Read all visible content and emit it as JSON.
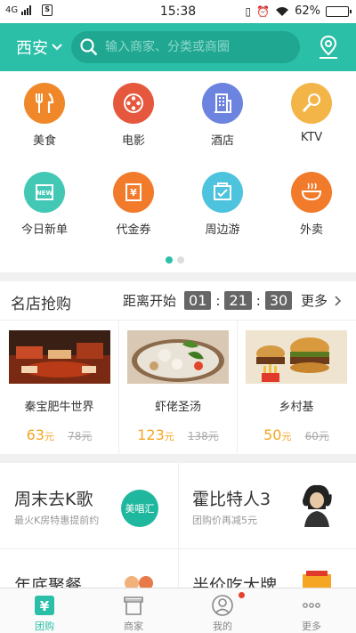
{
  "status_bar": {
    "network": "4G",
    "time": "15:38",
    "battery": "62%",
    "battery_level": 0.62
  },
  "header": {
    "city": "西安",
    "search_placeholder": "输入商家、分类或商圈",
    "accent_color": "#2bbfa8"
  },
  "categories": [
    {
      "label": "美食",
      "icon": "food-icon",
      "color": "#f0882a"
    },
    {
      "label": "电影",
      "icon": "film-reel-icon",
      "color": "#e5583d"
    },
    {
      "label": "酒店",
      "icon": "hotel-icon",
      "color": "#6c84e0"
    },
    {
      "label": "KTV",
      "icon": "microphone-icon",
      "color": "#f3b547"
    },
    {
      "label": "今日新单",
      "icon": "new-badge-icon",
      "color": "#42c8b5"
    },
    {
      "label": "代金券",
      "icon": "voucher-icon",
      "color": "#f27a2b"
    },
    {
      "label": "周边游",
      "icon": "travel-ticket-icon",
      "color": "#4ec3dd"
    },
    {
      "label": "外卖",
      "icon": "takeout-bowl-icon",
      "color": "#f27a2b"
    }
  ],
  "page_indicator": {
    "total": 2,
    "current": 1
  },
  "flash_sale": {
    "title": "名店抢购",
    "countdown_label": "距离开始",
    "hours": "01",
    "minutes": "21",
    "seconds": "30",
    "more_label": "更多",
    "products": [
      {
        "name": "秦宝肥牛世界",
        "price": "63",
        "unit": "元",
        "original": "78元"
      },
      {
        "name": "虾佬圣汤",
        "price": "123",
        "unit": "元",
        "original": "138元"
      },
      {
        "name": "乡村基",
        "price": "50",
        "unit": "元",
        "original": "60元"
      }
    ]
  },
  "promos": [
    {
      "title": "周末去K歌",
      "subtitle": "最火K房特惠提前约",
      "badge": "美唱汇"
    },
    {
      "title": "霍比特人3",
      "subtitle": "团购价再减5元"
    },
    {
      "title": "年底聚餐",
      "subtitle": ""
    },
    {
      "title": "半价吃大牌",
      "subtitle": ""
    }
  ],
  "tabs": [
    {
      "label": "团购",
      "icon": "yuan-bag-icon",
      "active": true
    },
    {
      "label": "商家",
      "icon": "storefront-icon"
    },
    {
      "label": "我的",
      "icon": "user-icon",
      "has_dot": true
    },
    {
      "label": "更多",
      "icon": "more-dots-icon"
    }
  ]
}
